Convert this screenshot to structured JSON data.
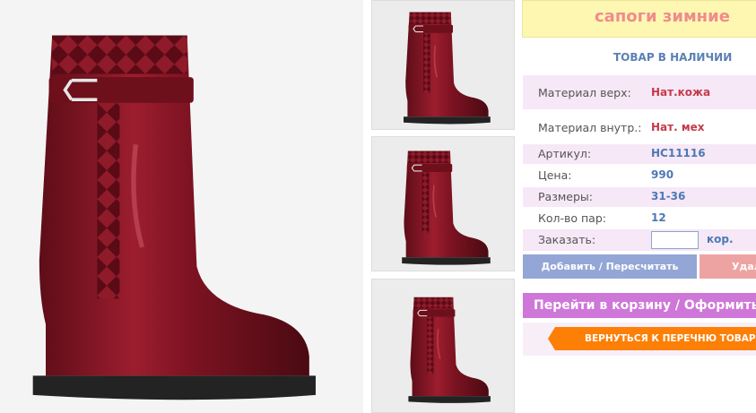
{
  "product": {
    "title": "сапоги зимние",
    "stock_status": "ТОВАР В НАЛИЧИИ"
  },
  "specs": [
    {
      "label": "Материал верх:",
      "value": "Нат.кожа"
    },
    {
      "label": "Материал внутр.:",
      "value": "Нат. мех"
    },
    {
      "label": "Артикул:",
      "value": "HC11116"
    },
    {
      "label": "Цена:",
      "value": "990"
    },
    {
      "label": "Размеры:",
      "value": "31-36"
    },
    {
      "label": "Кол-во пар:",
      "value": "12"
    }
  ],
  "order": {
    "label": "Заказать:",
    "value": "",
    "unit": "кор."
  },
  "buttons": {
    "add_recalc": "Добавить / Пересчитать",
    "delete": "Удалить",
    "go_to_cart": "Перейти в корзину / Оформить",
    "back_to_list": "ВЕРНУТЬСЯ К ПЕРЕЧНЮ ТОВАРОВ"
  },
  "images": {
    "main": "boot-photo",
    "thumbnails": [
      "boot-photo",
      "boot-photo",
      "boot-photo"
    ]
  },
  "colors": {
    "boot": "#8b1526",
    "title_bg": "#fdf7b2",
    "title_text": "#f08c8c",
    "row_pink": "#f6e8f6",
    "value_blue": "#4e78b4",
    "value_red": "#c43a4a",
    "add_button": "#93a6d6",
    "delete_button": "#eea3a3",
    "cart_button": "#cf77d9",
    "back_button": "#fd7f06"
  }
}
